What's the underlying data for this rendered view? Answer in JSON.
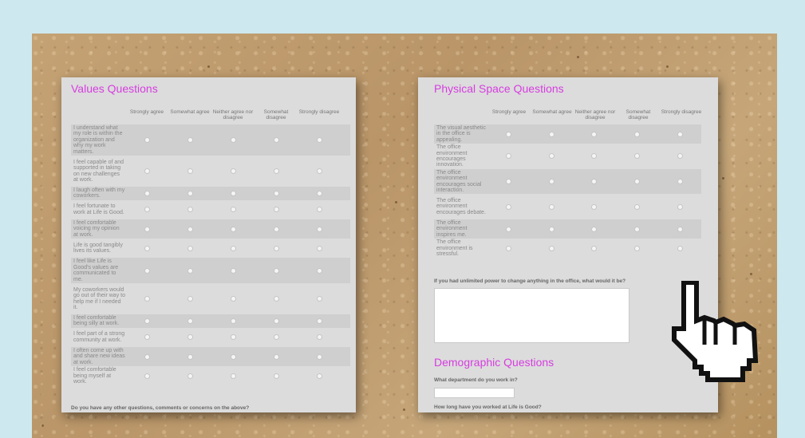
{
  "values_form": {
    "title": "Values Questions",
    "scale": [
      "Strongly agree",
      "Somewhat agree",
      "Neither agree nor disagree",
      "Somewhat disagree",
      "Strongly disagree"
    ],
    "questions": [
      "I understand what my role is within the organization and why my work matters.",
      "I feel capable of and supported in taking on new challenges at work.",
      "I laugh often with my coworkers.",
      "I feel fortunate to work at Life is Good.",
      "I feel comfortable voicing my opinion at work.",
      "Life is good tangibly lives its values.",
      "I feel like Life is Good's values are communicated to me.",
      "My coworkers would go out of their way to help me if I needed it.",
      "I feel comfortable being silly at work.",
      "I feel part of a strong community at work.",
      "I often come up with and share new ideas at work.",
      "I feel comfortable being myself at work."
    ],
    "footer_prompt": "Do you have any other questions, comments or concerns on the above?"
  },
  "space_form": {
    "title": "Physical Space Questions",
    "scale": [
      "Strongly agree",
      "Somewhat agree",
      "Neither agree nor disagree",
      "Somewhat disagree",
      "Strongly disagree"
    ],
    "questions": [
      "The visual aesthetic in the office is appealing.",
      "The office environment encourages innovation.",
      "The office environment encourages social interaction.",
      "The office environment encourages debate.",
      "The office environment inspires me.",
      "The office environment is stressful."
    ],
    "open_prompt": "If you had unlimited power to change anything in the office, what would it be?",
    "demographic_title": "Demographic Questions",
    "department_prompt": "What department do you work in?",
    "tenure_prompt": "How long have you worked at Life is Good?"
  },
  "cursor_icon": "hand-pointer-icon",
  "colors": {
    "accent": "#d63de0",
    "background": "#cde8ef",
    "paper": "#dcdcdc"
  }
}
